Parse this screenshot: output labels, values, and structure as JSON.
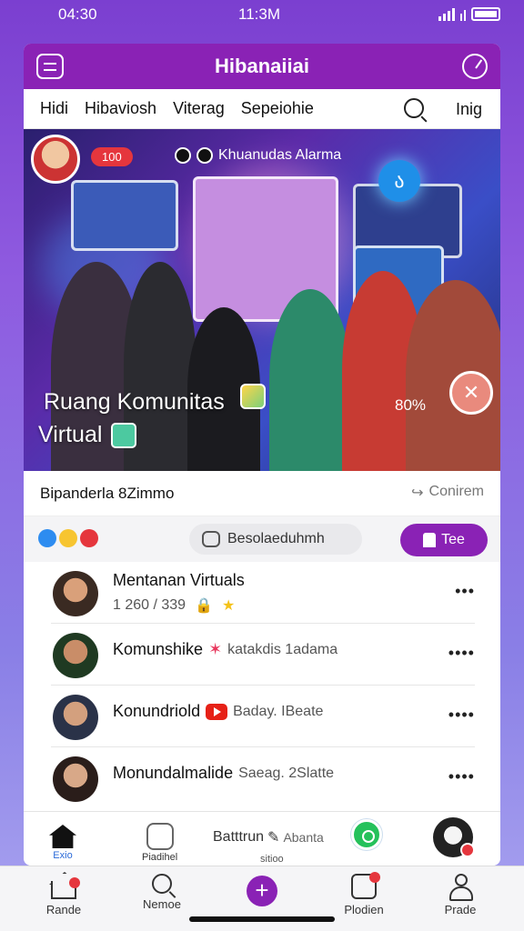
{
  "status_bar": {
    "left_time": "04:30",
    "center_time": "11:3M"
  },
  "app": {
    "title": "Hibanaiiai"
  },
  "tabs": [
    {
      "label": "Hidi"
    },
    {
      "label": "Hibaviosh"
    },
    {
      "label": "Viterag"
    },
    {
      "label": "Sepeiohie"
    }
  ],
  "tabs_right": "Inig",
  "hero": {
    "badge": "100",
    "live_label": "Khuanudas Alarma",
    "caption_line1": "Ruang Komunitas",
    "caption_line2": "Virtual",
    "percent": "80%",
    "share_glyph": "ა"
  },
  "post": {
    "caption": "Bipanderla 8Zimmo",
    "share_label": "Conirem"
  },
  "actions": {
    "comment_placeholder": "Besolaeduhmh",
    "primary_button": "Tee"
  },
  "list": [
    {
      "name": "Mentanan Virtuals",
      "sub_count": "1 260 / 339"
    },
    {
      "name": "Komunshike",
      "meta": "katakdis 1adama"
    },
    {
      "name": "Konundriold",
      "meta": "Baday. IBeate"
    },
    {
      "name": "Monundalmalide",
      "meta": "Saeag. 2Slatte"
    }
  ],
  "inner_nav": {
    "home_label": "Exio",
    "pod_label": "Piadihel",
    "center_label": "Batttrun",
    "center_meta": "Abanta",
    "center_sub": "sitioo"
  },
  "bottom_nav": [
    {
      "label": "Rande"
    },
    {
      "label": "Nemoe"
    },
    {
      "label": ""
    },
    {
      "label": "Plodien"
    },
    {
      "label": "Prade"
    }
  ],
  "colors": {
    "brand": "#8a22b5",
    "accent_red": "#e5363d",
    "link_blue": "#2a6ad8"
  },
  "icons": [
    "menu-icon",
    "timer-icon",
    "search-icon",
    "share-icon",
    "comment-icon",
    "more-icon",
    "home-icon",
    "whatsapp-icon",
    "plus-icon",
    "person-icon"
  ]
}
